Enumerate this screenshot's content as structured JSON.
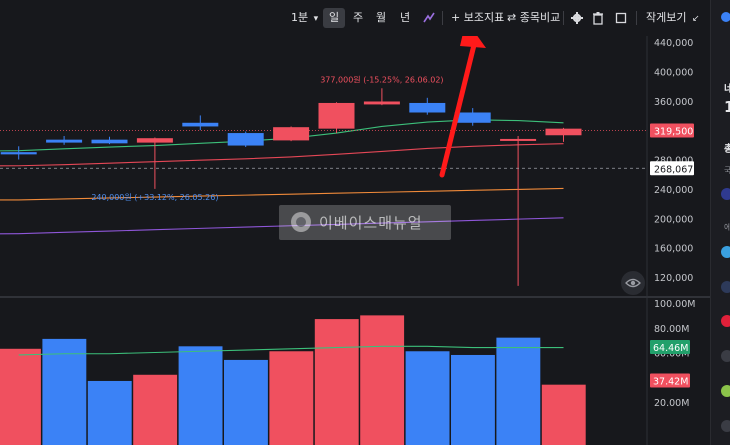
{
  "toolbar": {
    "interval_label": "1분",
    "period_tabs": [
      {
        "label": "일",
        "active": true
      },
      {
        "label": "주",
        "active": false
      },
      {
        "label": "월",
        "active": false
      },
      {
        "label": "년",
        "active": false
      }
    ],
    "indicator_label": "+ 보조지표",
    "compare_label": "⇄ 종목비교",
    "compact_view_label": "작게보기"
  },
  "colors": {
    "up": "#f0505f",
    "down": "#3b82f6",
    "background": "#17181c",
    "arrow": "#ff1a1a"
  },
  "price_chart": {
    "y_ticks": [
      "440,000",
      "400,000",
      "360,000",
      "320,000",
      "280,000",
      "240,000",
      "200,000",
      "160,000",
      "120,000"
    ],
    "current_price": "319,500",
    "reference_price": "268,067",
    "high_annotation": "377,000원 (-15.25%, 26.06.02)",
    "low_annotation": "240,000원 (+33.12%, 26.05.26)"
  },
  "volume_chart": {
    "y_ticks": [
      "100.00M",
      "80.00M",
      "60.00M",
      "40.00M",
      "20.00M"
    ],
    "ma_value": "64.46M",
    "current_value": "37.42M"
  },
  "chart_data": [
    {
      "type": "candlestick",
      "title": "",
      "ylim": [
        100000,
        450000
      ],
      "candles": [
        {
          "o": 290000,
          "h": 298000,
          "l": 280000,
          "c": 287000
        },
        {
          "o": 307000,
          "h": 312000,
          "l": 300000,
          "c": 303000
        },
        {
          "o": 307000,
          "h": 311000,
          "l": 301000,
          "c": 302000
        },
        {
          "o": 303000,
          "h": 310000,
          "l": 240000,
          "c": 309000
        },
        {
          "o": 330000,
          "h": 340000,
          "l": 320000,
          "c": 325000
        },
        {
          "o": 316000,
          "h": 318000,
          "l": 297000,
          "c": 299000
        },
        {
          "o": 306000,
          "h": 325000,
          "l": 305000,
          "c": 324000
        },
        {
          "o": 322000,
          "h": 358000,
          "l": 316000,
          "c": 357000
        },
        {
          "o": 355000,
          "h": 377000,
          "l": 354000,
          "c": 359000
        },
        {
          "o": 357000,
          "h": 364000,
          "l": 341000,
          "c": 344000
        },
        {
          "o": 344000,
          "h": 350000,
          "l": 326000,
          "c": 330000
        },
        {
          "o": 306000,
          "h": 312000,
          "l": 108000,
          "c": 308000
        },
        {
          "o": 313000,
          "h": 323000,
          "l": 304000,
          "c": 322000
        }
      ],
      "series": [
        {
          "color": "#3cbf7a",
          "values": [
            292000,
            294500,
            297000,
            299000,
            302000,
            305000,
            309000,
            316000,
            325000,
            331000,
            334000,
            333000,
            330000
          ]
        },
        {
          "color": "#e44756",
          "values": [
            271500,
            273000,
            275000,
            277000,
            279000,
            281000,
            283500,
            287000,
            291000,
            295000,
            298000,
            300000,
            301500
          ]
        },
        {
          "color": "#f08a3a",
          "values": [
            225000,
            226300,
            227600,
            228900,
            230200,
            231500,
            232800,
            234100,
            235400,
            236700,
            238000,
            239300,
            240600
          ]
        },
        {
          "color": "#8e56d8",
          "values": [
            179000,
            180800,
            182600,
            184400,
            186200,
            188000,
            189800,
            191600,
            193400,
            195200,
            197000,
            198800,
            200600
          ]
        }
      ]
    },
    {
      "type": "bar",
      "title": "",
      "ylim": [
        0,
        105
      ],
      "values": [
        63,
        71,
        37,
        42,
        65,
        54,
        61,
        87,
        90,
        61,
        58,
        72,
        34
      ],
      "directions": [
        "up",
        "down",
        "down",
        "up",
        "down",
        "down",
        "up",
        "up",
        "up",
        "down",
        "down",
        "down",
        "up"
      ],
      "series": [
        {
          "color": "#3cbf7a",
          "values": [
            58,
            59,
            59,
            60,
            61,
            62,
            63,
            64,
            65,
            65,
            64,
            64,
            64
          ]
        }
      ]
    }
  ],
  "watermark": {
    "text": "이베이스매뉴얼"
  },
  "right_panel": {
    "fragments": [
      "네",
      "1",
      "총",
      "국",
      "에"
    ]
  }
}
